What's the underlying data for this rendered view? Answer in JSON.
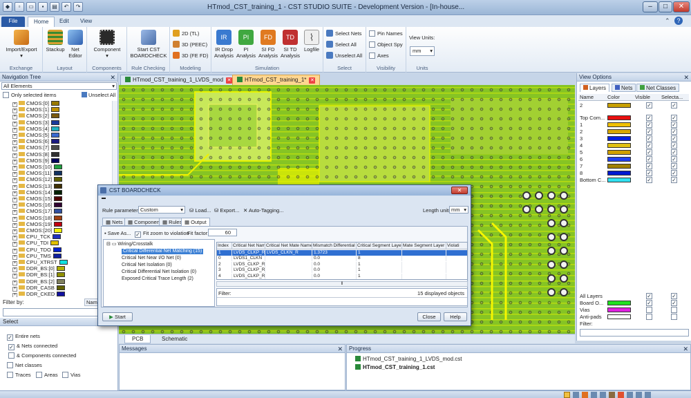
{
  "window": {
    "title": "HTmod_CST_training_1 - CST STUDIO SUITE - Development Version - [In-house..."
  },
  "menu_tabs": {
    "file": "File",
    "home": "Home",
    "edit": "Edit",
    "view": "View"
  },
  "ribbon": {
    "exchange": {
      "label": "Exchange",
      "import_export": "Import/Export"
    },
    "layout": {
      "label": "Layout",
      "stackup": "Stackup",
      "net_editor_1": "Net",
      "net_editor_2": "Editor"
    },
    "components": {
      "label": "Components",
      "component": "Component"
    },
    "rule_checking": {
      "label": "Rule Checking",
      "start_1": "Start CST",
      "start_2": "BOARDCHECK"
    },
    "modeling": {
      "label": "Modeling",
      "tl": "2D (TL)",
      "peec": "3D (PEEC)",
      "fefd": "3D (FE FD)"
    },
    "simulation": {
      "label": "Simulation",
      "ir_1": "IR Drop",
      "ir_2": "Analysis",
      "pi_1": "PI",
      "pi_2": "Analysis",
      "sifd_1": "SI FD",
      "sifd_2": "Analysis",
      "sitd_1": "SI TD",
      "sitd_2": "Analysis",
      "logfile": "Logfile",
      "ic_ir": "IR",
      "ic_pi": "PI",
      "ic_fd": "FD",
      "ic_td": "TD"
    },
    "select": {
      "label": "Select",
      "select_nets": "Select Nets",
      "select_all": "Select All",
      "unselect_all": "Unselect All"
    },
    "visibility": {
      "label": "Visibility",
      "pin_names": "Pin Names",
      "object_spy": "Object Spy",
      "axes": "Axes"
    },
    "units": {
      "label": "Units",
      "view_units": "View Units:",
      "value": "mm"
    }
  },
  "nav": {
    "title": "Navigation Tree",
    "filter": "All Elements",
    "only_selected": "Only selected items",
    "unselect_all": "Unselect All",
    "items": [
      {
        "label": "CMOS:[0]",
        "color": "#9a7a00"
      },
      {
        "label": "CMOS:[1]",
        "color": "#c09000"
      },
      {
        "label": "CMOS:[2]",
        "color": "#7a5a10"
      },
      {
        "label": "CMOS:[3]",
        "color": "#1a3a9a"
      },
      {
        "label": "CMOS:[4]",
        "color": "#20b0c0"
      },
      {
        "label": "CMOS:[5]",
        "color": "#3a6ad0"
      },
      {
        "label": "CMOS:[6]",
        "color": "#1a1a80"
      },
      {
        "label": "CMOS:[7]",
        "color": "#4a4a4a"
      },
      {
        "label": "CMOS:[8]",
        "color": "#303030"
      },
      {
        "label": "CMOS:[9]",
        "color": "#00005a"
      },
      {
        "label": "CMOS:[10]",
        "color": "#20a040"
      },
      {
        "label": "CMOS:[11]",
        "color": "#103060"
      },
      {
        "label": "CMOS:[12]",
        "color": "#606000"
      },
      {
        "label": "CMOS:[13]",
        "color": "#403000"
      },
      {
        "label": "CMOS:[14]",
        "color": "#002000"
      },
      {
        "label": "CMOS:[15]",
        "color": "#500000"
      },
      {
        "label": "CMOS:[16]",
        "color": "#300030"
      },
      {
        "label": "CMOS:[17]",
        "color": "#3050a0"
      },
      {
        "label": "CMOS:[18]",
        "color": "#a04010"
      },
      {
        "label": "CMOS:[19]",
        "color": "#c00010"
      },
      {
        "label": "CMOS:[20]",
        "color": "#f0f000"
      },
      {
        "label": "CPU_TCK",
        "color": "#2030c0"
      },
      {
        "label": "CPU_TDI",
        "color": "#e0c000"
      },
      {
        "label": "CPU_TDO",
        "color": "#0020d0"
      },
      {
        "label": "CPU_TMS",
        "color": "#1020a0"
      },
      {
        "label": "CPU_XTRST",
        "color": "#10e0e0"
      },
      {
        "label": "DDR_BS:[0]",
        "color": "#b0b000"
      },
      {
        "label": "DDR_BS:[1]",
        "color": "#909000"
      },
      {
        "label": "DDR_BS:[2]",
        "color": "#808060"
      },
      {
        "label": "DDR_CASB",
        "color": "#606000"
      },
      {
        "label": "DDR_CKED",
        "color": "#1010a0"
      }
    ]
  },
  "filter": {
    "title": "Filter by:",
    "name_col": "Name",
    "select_title": "Select",
    "entire_nets": "Entire nets",
    "nets_connected": "& Nets connected",
    "components_connected": "& Components connected",
    "net_classes": "Net classes",
    "traces": "Traces",
    "areas": "Areas",
    "vias": "Vias"
  },
  "doc_tabs": {
    "tab1": "HTmod_CST_training_1_LVDS_mod",
    "tab2": "HTmod_CST_training_1*"
  },
  "bottom_tabs": {
    "pcb": "PCB",
    "schematic": "Schematic"
  },
  "messages": {
    "title": "Messages"
  },
  "progress": {
    "title": "Progress",
    "items": [
      "HTmod_CST_training_1_LVDS_mod.cst",
      "HTmod_CST_training_1.cst"
    ]
  },
  "view_options": {
    "title": "View Options",
    "tabs": [
      "Layers",
      "Nets",
      "Net Classes"
    ],
    "headers": {
      "name": "Name",
      "color": "Color",
      "visible": "Visible",
      "selectable": "Selecta..."
    },
    "header_row": {
      "name": "2",
      "color": "#c8a000"
    },
    "layers": [
      {
        "name": "Top Com...",
        "color": "#e81010"
      },
      {
        "name": "1",
        "color": "#f0c000"
      },
      {
        "name": "2",
        "color": "#d8a800"
      },
      {
        "name": "3",
        "color": "#0020e0"
      },
      {
        "name": "4",
        "color": "#e0c010"
      },
      {
        "name": "5",
        "color": "#d0a000"
      },
      {
        "name": "6",
        "color": "#2040f0"
      },
      {
        "name": "7",
        "color": "#a08000"
      },
      {
        "name": "8",
        "color": "#0018d0"
      },
      {
        "name": "Bottom C...",
        "color": "#30e0f0"
      }
    ],
    "bottom_layers": [
      {
        "name": "All Layers",
        "color": ""
      },
      {
        "name": "Board O...",
        "color": "#20e020"
      },
      {
        "name": "Vias",
        "color": "#e020e0"
      },
      {
        "name": "Anti-pads",
        "color": "#ffffff"
      }
    ],
    "filter_label": "Filter:"
  },
  "dialog": {
    "title": "CST BOARDCHECK",
    "rule_params": "Rule parameters:",
    "rule_value": "Custom",
    "load": "Load...",
    "export": "Export...",
    "auto_tagging": "Auto-Tagging...",
    "length_units": "Length units:",
    "length_value": "mm",
    "tabs": [
      "Nets",
      "Components",
      "Rules",
      "Output"
    ],
    "save_as": "Save As...",
    "fit_zoom": "Fit zoom to violation",
    "fit_factor": "Fit factor:",
    "fit_value": "60",
    "tree": {
      "root": "Wiring/Crosstalk",
      "items": [
        "Critical Differential Net Matching (15)",
        "Critical Net Near I/O Net (0)",
        "Critical Net Isolation (0)",
        "Critical Differential Net Isolation (0)",
        "Exposed Critical Trace Length (2)"
      ]
    },
    "grid_headers": [
      "Index",
      "Critical Net Name",
      "Critical Net Mate Name",
      "Mismatch Differential",
      "Critical Segment Layer",
      "Mate Segment Layer",
      "Violati"
    ],
    "rows": [
      [
        "1",
        "LVDS_CLKP_R",
        "LVDS_CLKN_R",
        "1.3723",
        "1",
        "",
        ""
      ],
      [
        "0",
        "LVDS1_CLKN",
        "",
        "0.0",
        "8",
        "",
        ""
      ],
      [
        "2",
        "LVDS_CLKP_R",
        "",
        "0.0",
        "1",
        "",
        ""
      ],
      [
        "3",
        "LVDS_CLKP_R",
        "",
        "0.0",
        "1",
        "",
        ""
      ],
      [
        "4",
        "LVDS_CLKP_R",
        "",
        "0.0",
        "1",
        "",
        ""
      ]
    ],
    "filter": "Filter:",
    "displayed": "15 displayed objects",
    "start": "Start",
    "close": "Close",
    "help": "Help"
  },
  "colors": {
    "pcb_green": "#7fbf1f",
    "trace_yellow": "#e8f200",
    "accent": "#2a5aa6"
  }
}
